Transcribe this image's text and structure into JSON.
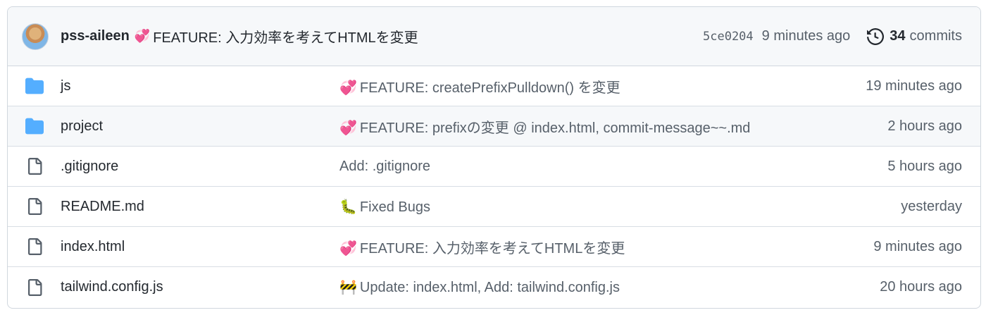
{
  "latest_commit": {
    "author": "pss-aileen",
    "emoji": "💞",
    "message": "FEATURE: 入力効率を考えてHTMLを変更",
    "sha": "5ce0204",
    "time": "9 minutes ago",
    "commit_count": "34",
    "commits_label": "commits"
  },
  "files": [
    {
      "type": "folder",
      "icon": "folder-icon",
      "name": "js",
      "emoji": "💞",
      "message": "FEATURE: createPrefixPulldown() を変更",
      "age": "19 minutes ago"
    },
    {
      "type": "folder",
      "icon": "folder-icon",
      "name": "project",
      "emoji": "💞",
      "message": "FEATURE: prefixの変更 @ index.html, commit-message~~.md",
      "age": "2 hours ago"
    },
    {
      "type": "file",
      "icon": "file-icon",
      "name": ".gitignore",
      "emoji": "",
      "message": "Add: .gitignore",
      "age": "5 hours ago"
    },
    {
      "type": "file",
      "icon": "file-icon",
      "name": "README.md",
      "emoji": "🐛",
      "message": "Fixed Bugs",
      "age": "yesterday"
    },
    {
      "type": "file",
      "icon": "file-icon",
      "name": "index.html",
      "emoji": "💞",
      "message": "FEATURE: 入力効率を考えてHTMLを変更",
      "age": "9 minutes ago"
    },
    {
      "type": "file",
      "icon": "file-icon",
      "name": "tailwind.config.js",
      "emoji": "🚧",
      "message": "Update: index.html, Add: tailwind.config.js",
      "age": "20 hours ago"
    }
  ],
  "colors": {
    "folder": "#54aeff",
    "file_icon": "#57606a",
    "border": "#d0d7de",
    "header_bg": "#f6f8fa",
    "muted_text": "#57606a"
  }
}
